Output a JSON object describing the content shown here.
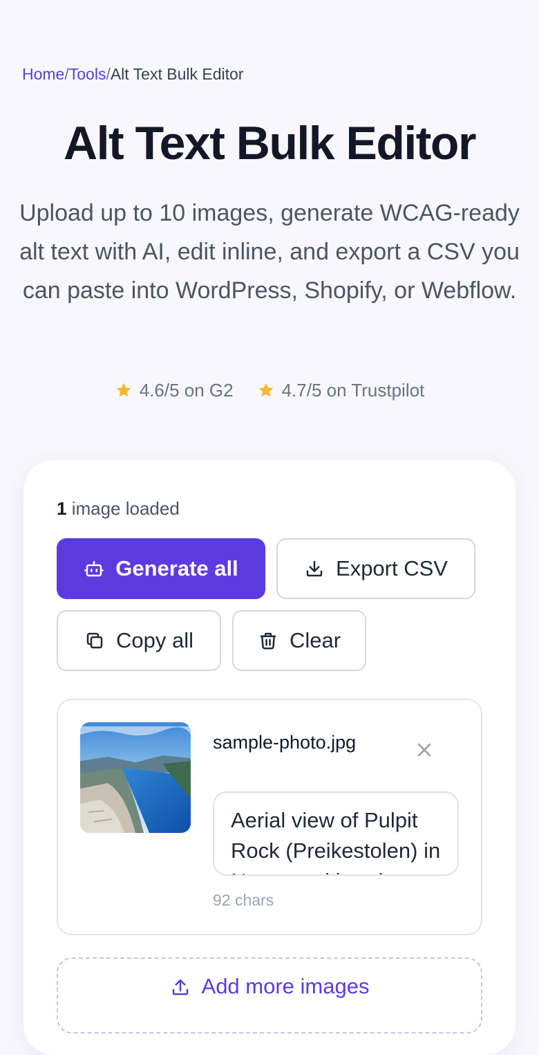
{
  "breadcrumb": {
    "items": [
      "Home",
      "Tools",
      "Alt Text Bulk Editor"
    ],
    "separator": "/"
  },
  "header": {
    "title": "Alt Text Bulk Editor",
    "subtitle": "Upload up to 10 images, generate WCAG-ready alt text with AI, edit inline, and export a CSV you can paste into WordPress, Shopify, or Webflow."
  },
  "ratings": [
    {
      "icon": "star-icon",
      "text": "4.6/5 on G2"
    },
    {
      "icon": "star-icon",
      "text": "4.7/5 on Trustpilot"
    }
  ],
  "editor": {
    "loaded_count": "1",
    "loaded_label": " image loaded",
    "actions": {
      "generate_all": "Generate all",
      "export_csv": "Export CSV",
      "copy_all": "Copy all",
      "clear": "Clear"
    },
    "images": [
      {
        "file_name": "sample-photo.jpg",
        "alt_text": "Aerial view of Pulpit Rock (Preikestolen) in Norway with a deep blue fjord below and cloudy sky",
        "char_count": "92 chars"
      }
    ],
    "add_more_label": "Add more images"
  },
  "colors": {
    "accent": "#5b3be0",
    "link": "#5b3fd6",
    "star": "#f5b82e",
    "background": "#f8f7fd"
  }
}
